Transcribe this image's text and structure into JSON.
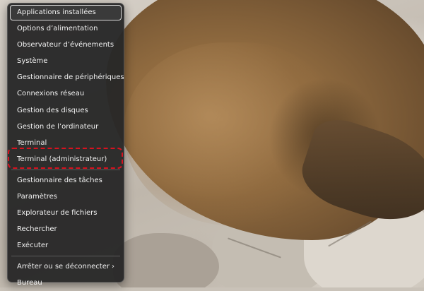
{
  "wallpaper": {
    "subject": "sea-lion-on-rocks"
  },
  "menu": {
    "items": [
      {
        "label": "Applications installées",
        "selected": true
      },
      {
        "label": "Options d’alimentation"
      },
      {
        "label": "Observateur d’événements"
      },
      {
        "label": "Système"
      },
      {
        "label": "Gestionnaire de périphériques"
      },
      {
        "label": "Connexions réseau"
      },
      {
        "label": "Gestion des disques"
      },
      {
        "label": "Gestion de l’ordinateur"
      },
      {
        "label": "Terminal"
      },
      {
        "label": "Terminal (administrateur)"
      },
      {
        "label": "Gestionnaire des tâches"
      },
      {
        "label": "Paramètres"
      },
      {
        "label": "Explorateur de fichiers"
      },
      {
        "label": "Rechercher"
      },
      {
        "label": "Exécuter"
      },
      {
        "label": "Arrêter ou se déconnecter",
        "has_submenu": true,
        "submenu_icon": "chevron-right-icon",
        "submenu_glyph": "›"
      },
      {
        "label": "Bureau"
      }
    ]
  },
  "annotation": {
    "highlighted_item": "Terminal (administrateur)",
    "color": "#d8121f"
  }
}
